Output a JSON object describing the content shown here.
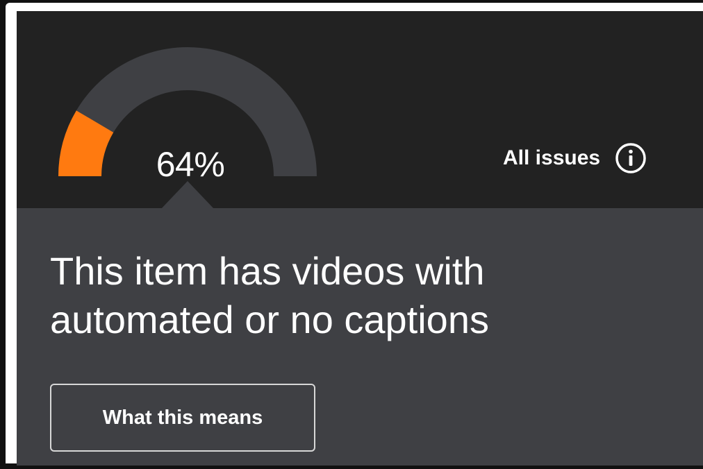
{
  "score": {
    "percent_label": "64%",
    "fraction": 0.17,
    "colors": {
      "filled": "#ff7a10",
      "track": "#3f4044"
    }
  },
  "all_issues": {
    "label": "All issues",
    "icon": "info-circle-icon"
  },
  "message": {
    "line1": "This item has videos with",
    "line2": "automated or no captions"
  },
  "cta": {
    "label": "What this means"
  }
}
